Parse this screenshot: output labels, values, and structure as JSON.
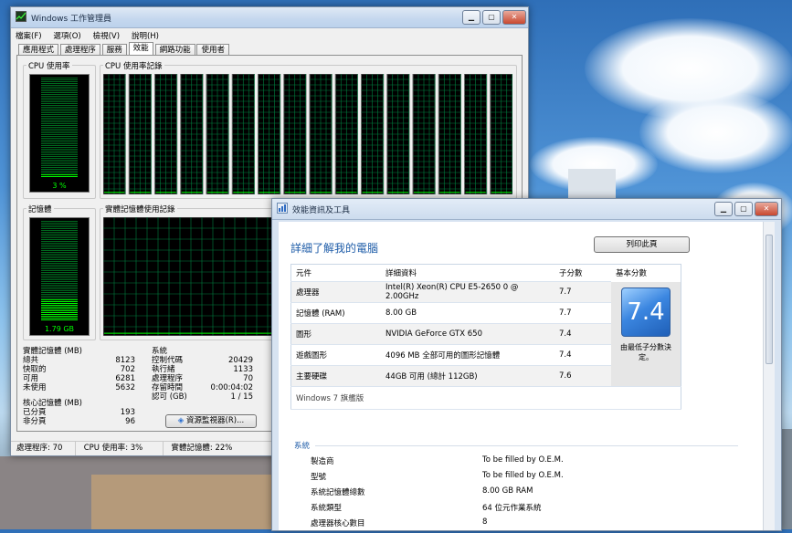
{
  "task_manager": {
    "title": "Windows 工作管理員",
    "menu": [
      "檔案(F)",
      "選項(O)",
      "檢視(V)",
      "說明(H)"
    ],
    "tabs": [
      "應用程式",
      "處理程序",
      "服務",
      "效能",
      "網路功能",
      "使用者"
    ],
    "active_tab": 3,
    "cpu_usage_label": "CPU 使用率",
    "cpu_history_label": "CPU 使用率記錄",
    "cpu_percent_text": "3 %",
    "memory_label": "記憶體",
    "memory_history_label": "實體記憶體使用記錄",
    "memory_value_text": "1.79 GB",
    "physical_memory": {
      "title": "實體記憶體 (MB)",
      "rows": [
        {
          "label": "總共",
          "value": "8123"
        },
        {
          "label": "快取的",
          "value": "702"
        },
        {
          "label": "可用",
          "value": "6281"
        },
        {
          "label": "未使用",
          "value": "5632"
        }
      ]
    },
    "system": {
      "title": "系統",
      "rows": [
        {
          "label": "控制代碼",
          "value": "20429"
        },
        {
          "label": "執行緒",
          "value": "1133"
        },
        {
          "label": "處理程序",
          "value": "70"
        },
        {
          "label": "存留時間",
          "value": "0:00:04:02"
        },
        {
          "label": "認可 (GB)",
          "value": "1 / 15"
        }
      ]
    },
    "kernel_memory": {
      "title": "核心記憶體 (MB)",
      "rows": [
        {
          "label": "已分頁",
          "value": "193"
        },
        {
          "label": "非分頁",
          "value": "96"
        }
      ]
    },
    "resource_monitor_button": "資源監視器(R)...",
    "status": {
      "processes": "處理程序: 70",
      "cpu": "CPU 使用率: 3%",
      "memory": "實體記憶體: 22%"
    },
    "cpu_usage_level": 0.03,
    "memory_usage_level": 0.22,
    "graph_color": "#00ff00",
    "grid_color": "#008040"
  },
  "perf_info": {
    "title": "效能資訊及工具",
    "heading": "詳細了解我的電腦",
    "print_button": "列印此頁",
    "columns": [
      "元件",
      "詳細資料",
      "子分數",
      "基本分數"
    ],
    "rows": [
      {
        "component": "處理器",
        "detail": "Intel(R) Xeon(R) CPU E5-2650 0 @ 2.00GHz",
        "score": "7.7"
      },
      {
        "component": "記憶體 (RAM)",
        "detail": "8.00 GB",
        "score": "7.7"
      },
      {
        "component": "圖形",
        "detail": "NVIDIA GeForce GTX 650",
        "score": "7.4"
      },
      {
        "component": "遊戲圖形",
        "detail": "4096 MB 全部可用的圖形記憶體",
        "score": "7.4"
      },
      {
        "component": "主要硬碟",
        "detail": "44GB 可用 (總計 112GB)",
        "score": "7.6"
      }
    ],
    "base_score": "7.4",
    "base_score_note": "由最低子分數決定。",
    "edition": "Windows 7 旗艦版",
    "system_label": "系統",
    "system_rows": [
      {
        "label": "製造商",
        "value": "To be filled by O.E.M."
      },
      {
        "label": "型號",
        "value": "To be filled by O.E.M."
      },
      {
        "label": "系統記憶體總數",
        "value": "8.00 GB RAM"
      },
      {
        "label": "系統類型",
        "value": "64 位元作業系統"
      },
      {
        "label": "處理器核心數目",
        "value": "8"
      }
    ],
    "accent_color": "#1e5ca8"
  }
}
